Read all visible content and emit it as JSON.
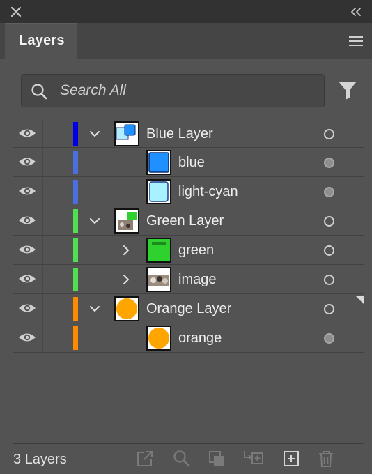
{
  "panel": {
    "tab_label": "Layers"
  },
  "search": {
    "placeholder": "Search All"
  },
  "rows": [
    {
      "name": "Blue Layer",
      "level": 0,
      "color": "#0000e6",
      "expand": "down",
      "thumb": "blue-layer-thumb",
      "target": "empty"
    },
    {
      "name": "blue",
      "level": 1,
      "color": "#4c6fe0",
      "expand": "none",
      "thumb": "blue-square",
      "target": "filled"
    },
    {
      "name": "light-cyan",
      "level": 1,
      "color": "#4c6fe0",
      "expand": "none",
      "thumb": "light-cyan-square",
      "target": "filled"
    },
    {
      "name": "Green Layer",
      "level": 0,
      "color": "#4ee04e",
      "expand": "down",
      "thumb": "green-layer-thumb",
      "target": "empty"
    },
    {
      "name": "green",
      "level": 1,
      "color": "#4ee04e",
      "expand": "right",
      "thumb": "green-rect",
      "target": "empty"
    },
    {
      "name": "image",
      "level": 1,
      "color": "#4ee04e",
      "expand": "right",
      "thumb": "photo",
      "target": "empty"
    },
    {
      "name": "Orange Layer",
      "level": 0,
      "color": "#ff8a00",
      "expand": "down",
      "thumb": "orange-circle",
      "target": "empty"
    },
    {
      "name": "orange",
      "level": 1,
      "color": "#ff8a00",
      "expand": "none",
      "thumb": "orange-circle",
      "target": "filled"
    }
  ],
  "footer": {
    "layer_count": "3 Layers",
    "icons": [
      "export-icon",
      "locate-object-icon",
      "clipping-mask-icon",
      "create-sublayer-icon",
      "new-layer-icon",
      "delete-icon"
    ]
  },
  "colors": {
    "panel_bg": "#535353",
    "titlebar_bg": "#323232",
    "tabbar_bg": "#454545"
  }
}
